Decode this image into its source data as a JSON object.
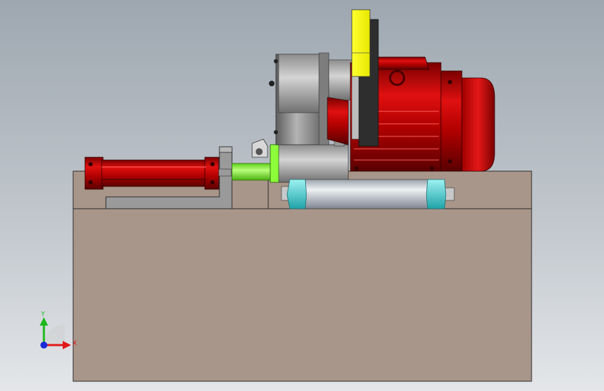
{
  "viewport": {
    "background_top": "#9ea7b0",
    "background_bottom": "#e4e6e9"
  },
  "model": {
    "base_color": "#a9968a",
    "motor_color": "#cc0000",
    "gearbox_color": "#8f8f8f",
    "disc_color": "#ffff00",
    "shaft_color": "#8cff3a",
    "bearing_color": "#49d8dc",
    "roller_color": "#c4cad2"
  },
  "triad": {
    "x_label": "X",
    "y_label": "Y",
    "x_color": "#e01818",
    "y_color": "#1eb81e",
    "z_color": "#1a2bd8"
  }
}
